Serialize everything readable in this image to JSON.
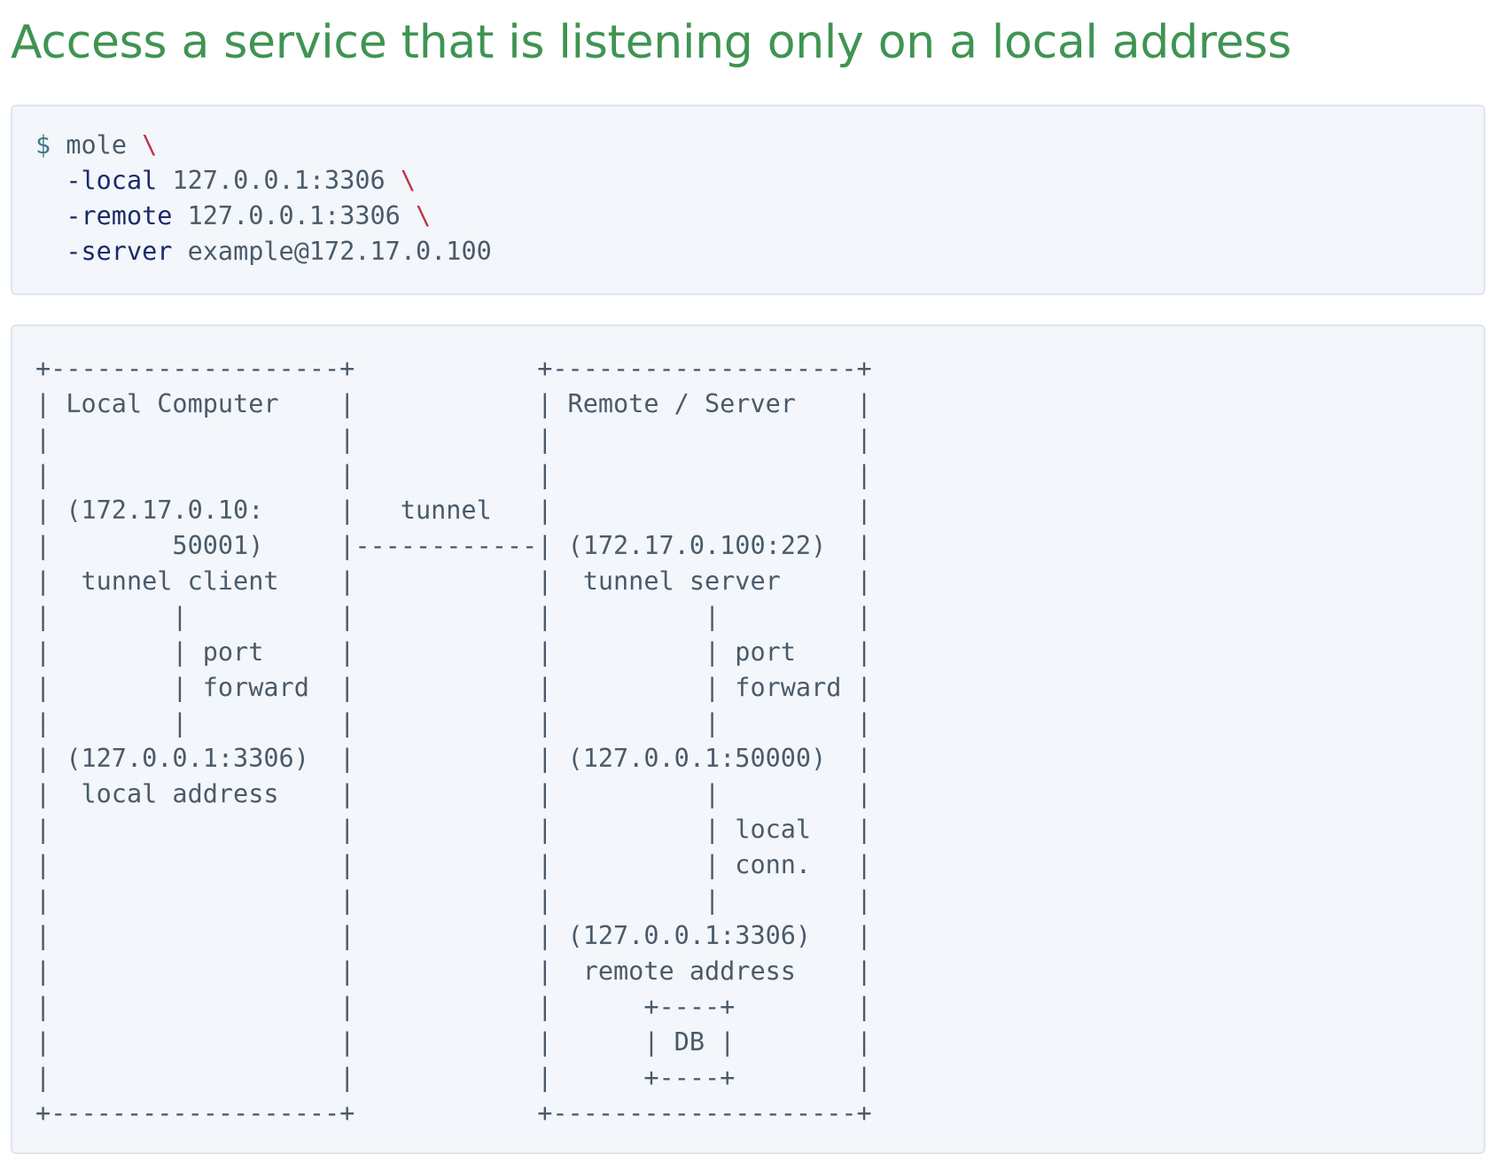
{
  "heading": "Access a service that is listening only on a local address",
  "command": {
    "prompt": "$",
    "program": "mole",
    "continuation": "\\",
    "args": [
      {
        "flag": "-local",
        "value": "127.0.0.1:3306",
        "continued": true
      },
      {
        "flag": "-remote",
        "value": "127.0.0.1:3306",
        "continued": true
      },
      {
        "flag": "-server",
        "value": "example@172.17.0.100",
        "continued": false
      }
    ]
  },
  "diagram_lines": [
    "+-------------------+            +--------------------+",
    "| Local Computer    |            | Remote / Server    |",
    "|                   |            |                    |",
    "|                   |            |                    |",
    "| (172.17.0.10:     |   tunnel   |                    |",
    "|        50001)     |------------| (172.17.0.100:22)  |",
    "|  tunnel client    |            |  tunnel server     |",
    "|        |          |            |          |         |",
    "|        | port     |            |          | port    |",
    "|        | forward  |            |          | forward |",
    "|        |          |            |          |         |",
    "| (127.0.0.1:3306)  |            | (127.0.0.1:50000)  |",
    "|  local address    |            |          |         |",
    "|                   |            |          | local   |",
    "|                   |            |          | conn.   |",
    "|                   |            |          |         |",
    "|                   |            | (127.0.0.1:3306)   |",
    "|                   |            |  remote address    |",
    "|                   |            |      +----+        |",
    "|                   |            |      | DB |        |",
    "|                   |            |      +----+        |",
    "+-------------------+            +--------------------+"
  ]
}
